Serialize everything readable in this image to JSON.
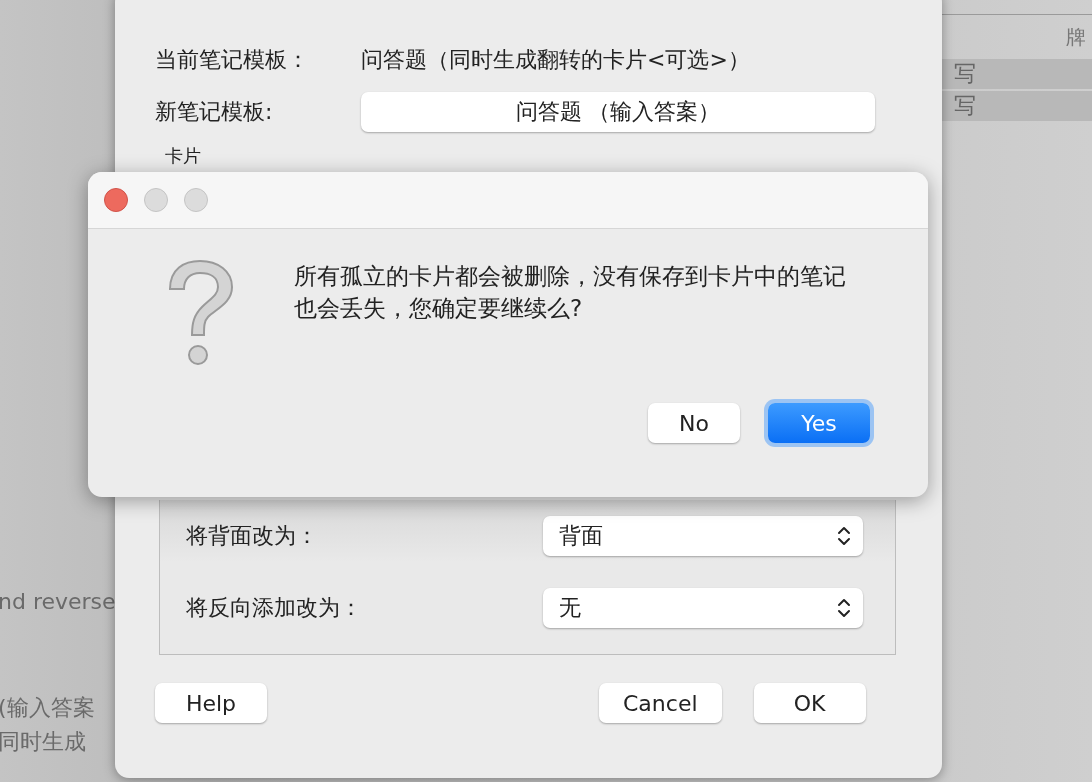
{
  "background": {
    "left_items": [
      {
        "label": "nd reverse"
      },
      {
        "label": "(输入答案"
      },
      {
        "label": "同时生成"
      }
    ],
    "table": {
      "header": "牌",
      "rows": [
        "写",
        "写"
      ]
    }
  },
  "sheet": {
    "fields": [
      {
        "kind": "text",
        "label": "当前笔记模板：",
        "value": "问答题（同时生成翻转的卡片<可选>）"
      },
      {
        "kind": "button",
        "label": "新笔记模板:",
        "value": "问答题 （输入答案）"
      }
    ],
    "section_label": "卡片",
    "mappings": [
      {
        "label": "将背面改为：",
        "value": "背面"
      },
      {
        "label": "将反向添加改为：",
        "value": "无"
      }
    ],
    "buttons": [
      {
        "label": "Help"
      },
      {
        "label": "Cancel"
      },
      {
        "label": "OK"
      }
    ]
  },
  "alert": {
    "message": "所有孤立的卡片都会被删除，没有保存到卡片中的笔记也会丢失，您确定要继续么?",
    "buttons": [
      {
        "label": "No",
        "default": false
      },
      {
        "label": "Yes",
        "default": true
      }
    ]
  }
}
